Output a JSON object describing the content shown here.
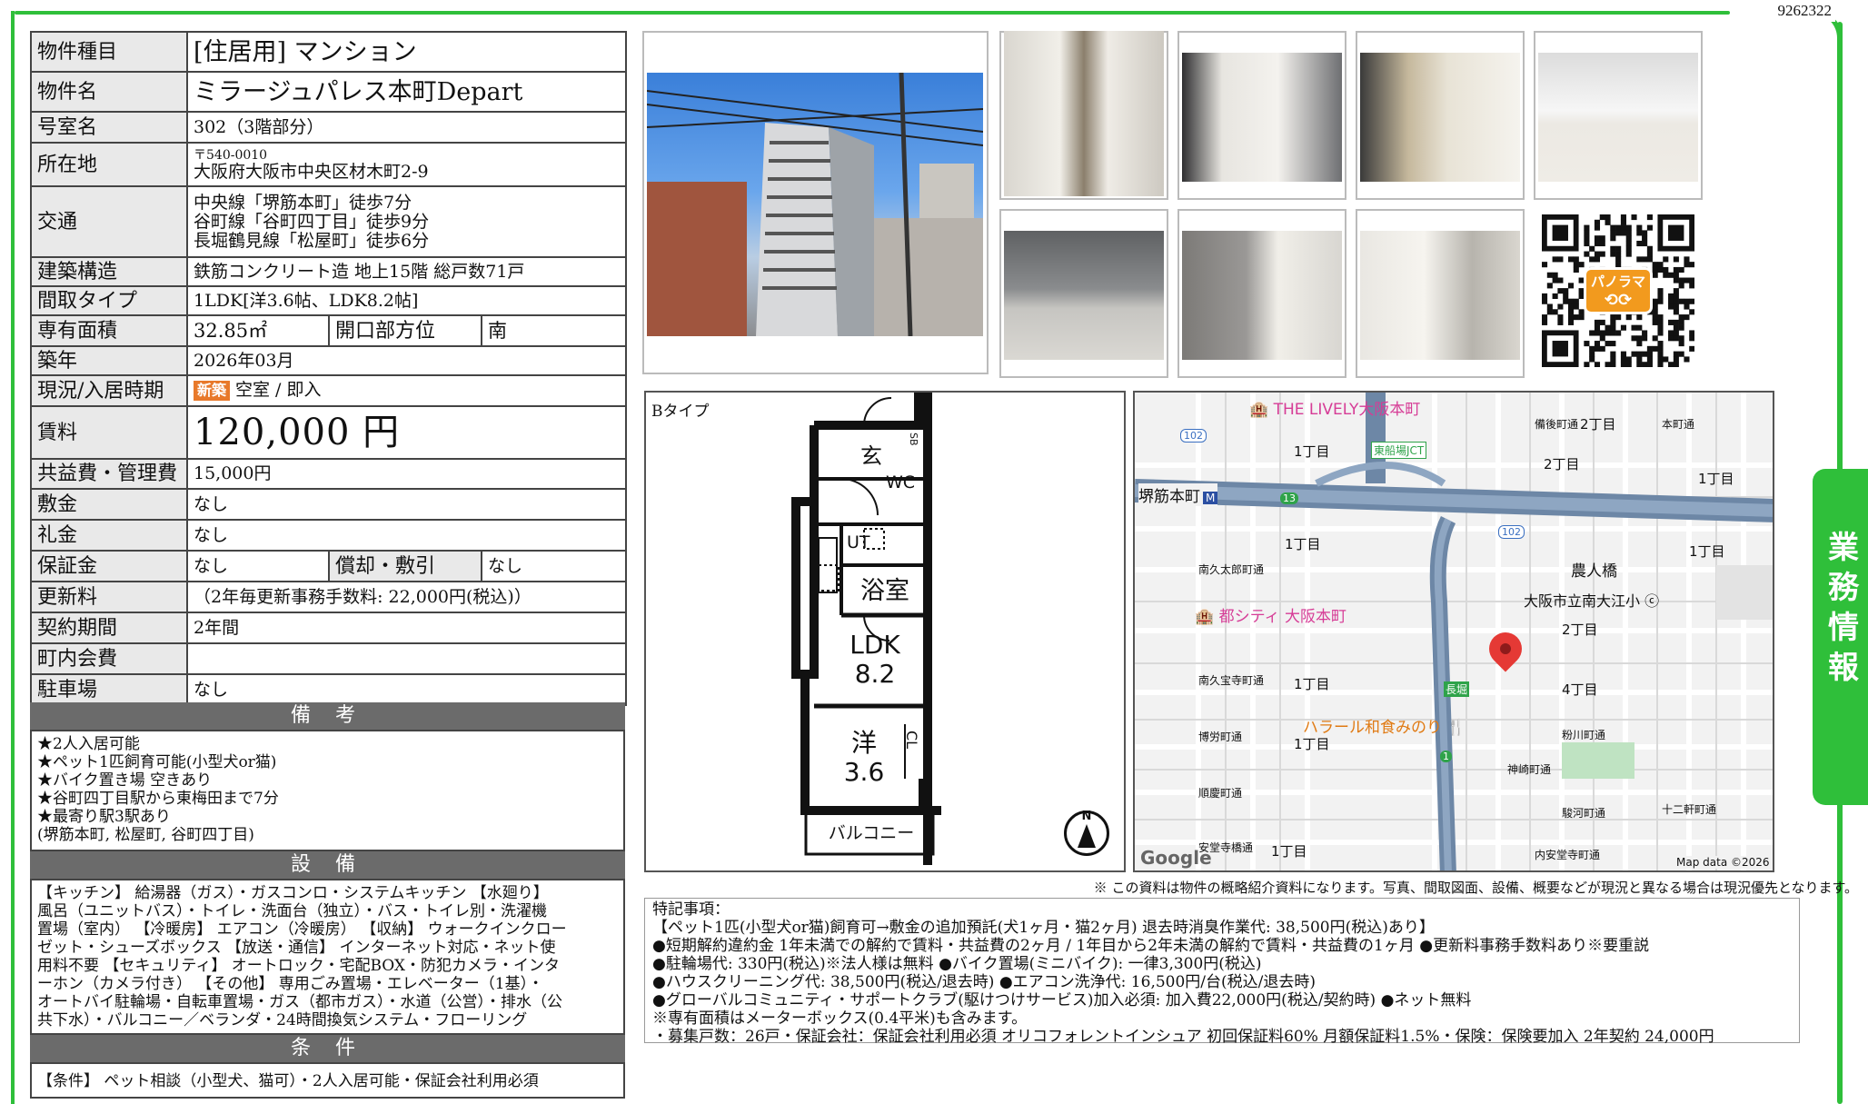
{
  "doc_number": "9262322",
  "side_tab": "業務情報",
  "table": {
    "type_label": "物件種目",
    "type_value": "[住居用] マンション",
    "name_label": "物件名",
    "name_value": "ミラージュパレス本町Depart",
    "room_label": "号室名",
    "room_value": "302（3階部分）",
    "address_label": "所在地",
    "address_postal": "〒540-0010",
    "address_value": "大阪府大阪市中央区材木町2-9",
    "transport_label": "交通",
    "transport": [
      "中央線「堺筋本町」徒歩7分",
      "谷町線「谷町四丁目」徒歩9分",
      "長堀鶴見線「松屋町」徒歩6分"
    ],
    "structure_label": "建築構造",
    "structure_value": "鉄筋コンクリート造 地上15階 総戸数71戸",
    "layout_label": "間取タイプ",
    "layout_value": "1LDK[洋3.6帖、LDK8.2帖]",
    "area_label": "専有面積",
    "area_value": "32.85㎡",
    "direction_label": "開口部方位",
    "direction_value": "南",
    "built_label": "築年",
    "built_value": "2026年03月",
    "status_label": "現況/入居時期",
    "status_badge": "新築",
    "status_value": "空室 / 即入",
    "rent_label": "賃料",
    "rent_value": "120,000 円",
    "fee_label": "共益費・管理費",
    "fee_value": "15,000円",
    "deposit_label": "敷金",
    "deposit_value": "なし",
    "keymoney_label": "礼金",
    "keymoney_value": "なし",
    "guarantee_label": "保証金",
    "guarantee_value": "なし",
    "amort_label": "償却・敷引",
    "amort_value": "なし",
    "renewal_label": "更新料",
    "renewal_value": "（2年毎更新事務手数料: 22,000円(税込)）",
    "contract_label": "契約期間",
    "contract_value": "2年間",
    "town_label": "町内会費",
    "town_value": "",
    "parking_label": "駐車場",
    "parking_value": "なし"
  },
  "remarks": {
    "heading": "備 考",
    "lines": [
      "★2人入居可能",
      "★ペット1匹飼育可能(小型犬or猫)",
      "★バイク置き場 空きあり",
      "★谷町四丁目駅から東梅田まで7分",
      "★最寄り駅3駅あり",
      "(堺筋本町, 松屋町, 谷町四丁目)"
    ]
  },
  "facilities": {
    "heading": "設 備",
    "lines": [
      "【キッチン】 給湯器（ガス）・ガスコンロ・システムキッチン 【水廻り】",
      "風呂（ユニットバス）・トイレ・洗面台（独立）・バス・トイレ別・洗濯機",
      "置場（室内） 【冷暖房】 エアコン（冷暖房） 【収納】 ウォークインクロー",
      "ゼット・シューズボックス 【放送・通信】 インターネット対応・ネット使",
      "用料不要 【セキュリティ】 オートロック・宅配BOX・防犯カメラ・インタ",
      "ーホン（カメラ付き） 【その他】 専用ごみ置場・エレベーター（1基）・",
      "オートバイ駐輪場・自転車置場・ガス（都市ガス）・水道（公営）・排水（公",
      "共下水）・バルコニー／ベランダ・24時間換気システム・フローリング"
    ]
  },
  "conditions": {
    "heading": "条 件",
    "text": "【条件】 ペット相談（小型犬、猫可）・2人入居可能・保証会社利用必須"
  },
  "qr_label": "パノラマ",
  "floorplan": {
    "type_label": "Bタイプ",
    "rooms": {
      "entry": "玄",
      "sb": "SB",
      "wc": "WC",
      "ut": "UT",
      "bath": "浴室",
      "ldk": "LDK",
      "ldk_size": "8.2",
      "western": "洋",
      "western_size": "3.6",
      "cl": "CL",
      "balcony": "バルコニー"
    },
    "north": "N"
  },
  "map": {
    "poi_1": "THE LIVELY大阪本町",
    "poi_2": "都シティ 大阪本町",
    "poi_3": "ハラール和食みのり",
    "station": "堺筋本町",
    "school": "大阪市立南大江小",
    "area_1": "農人橋",
    "jct": "東船場JCT",
    "chome_labels": [
      "1丁目",
      "2丁目",
      "1丁目",
      "2丁目",
      "1丁目",
      "1丁目",
      "2丁目",
      "1丁目",
      "4丁目",
      "1丁目",
      "1丁目"
    ],
    "streets": [
      "南久太郎町通",
      "南久宝寺町通",
      "博労町通",
      "順慶町通",
      "安堂寺橋通",
      "内安堂寺町通",
      "粉川町通",
      "神崎町通",
      "駿河町通",
      "十二軒町通",
      "備後町通",
      "本町通"
    ],
    "route_badges": [
      "102",
      "13",
      "102",
      "1"
    ],
    "nagahori": "長堀",
    "google": "Google",
    "attribution": "Map data ©2026"
  },
  "disclaimer": "※ この資料は物件の概略紹介資料になります。写真、間取図面、設備、概要などが現況と異なる場合は現況優先となります。",
  "special_notes": [
    "特記事項：",
    "【ペット1匹(小型犬or猫)飼育可→敷金の追加預託(犬1ヶ月・猫2ヶ月) 退去時消臭作業代: 38,500円(税込)あり】",
    "●短期解約違約金 1年未満での解約で賃料・共益費の2ヶ月 / 1年目から2年未満の解約で賃料・共益費の1ヶ月 ●更新料事務手数料あり※要重説",
    "●駐輪場代: 330円(税込)※法人様は無料 ●バイク置場(ミニバイク): 一律3,300円(税込)",
    "●ハウスクリーニング代: 38,500円(税込/退去時) ●エアコン洗浄代: 16,500円/台(税込/退去時)",
    "●グローバルコミュニティ・サポートクラブ(駆けつけサービス)加入必須: 加入費22,000円(税込/契約時) ●ネット無料",
    "※専有面積はメーターボックス(0.4平米)も含みます。",
    "・募集戸数：26戸・保証会社：保証会社利用必須 オリコフォレントインシュア 初回保証料60% 月額保証料1.5%・保険：保険要加入 2年契約 24,000円"
  ]
}
